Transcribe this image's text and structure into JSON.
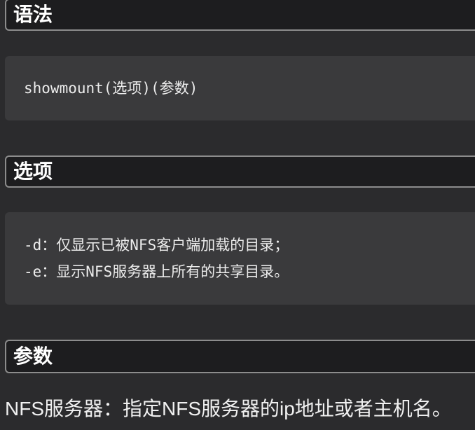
{
  "sections": [
    {
      "title": "语法",
      "code_lines": [
        "showmount(选项)(参数)"
      ]
    },
    {
      "title": "选项",
      "code_lines": [
        "-d：仅显示已被NFS客户端加载的目录；",
        "-e：显示NFS服务器上所有的共享目录。"
      ]
    },
    {
      "title": "参数",
      "paragraph": "NFS服务器：指定NFS服务器的ip地址或者主机名。"
    }
  ],
  "colors": {
    "background": "#2b2b2d",
    "header_background": "#1d1d1f",
    "header_border": "#8c8c8c",
    "code_background": "#3a3a3c",
    "text": "#e6e6e6"
  }
}
